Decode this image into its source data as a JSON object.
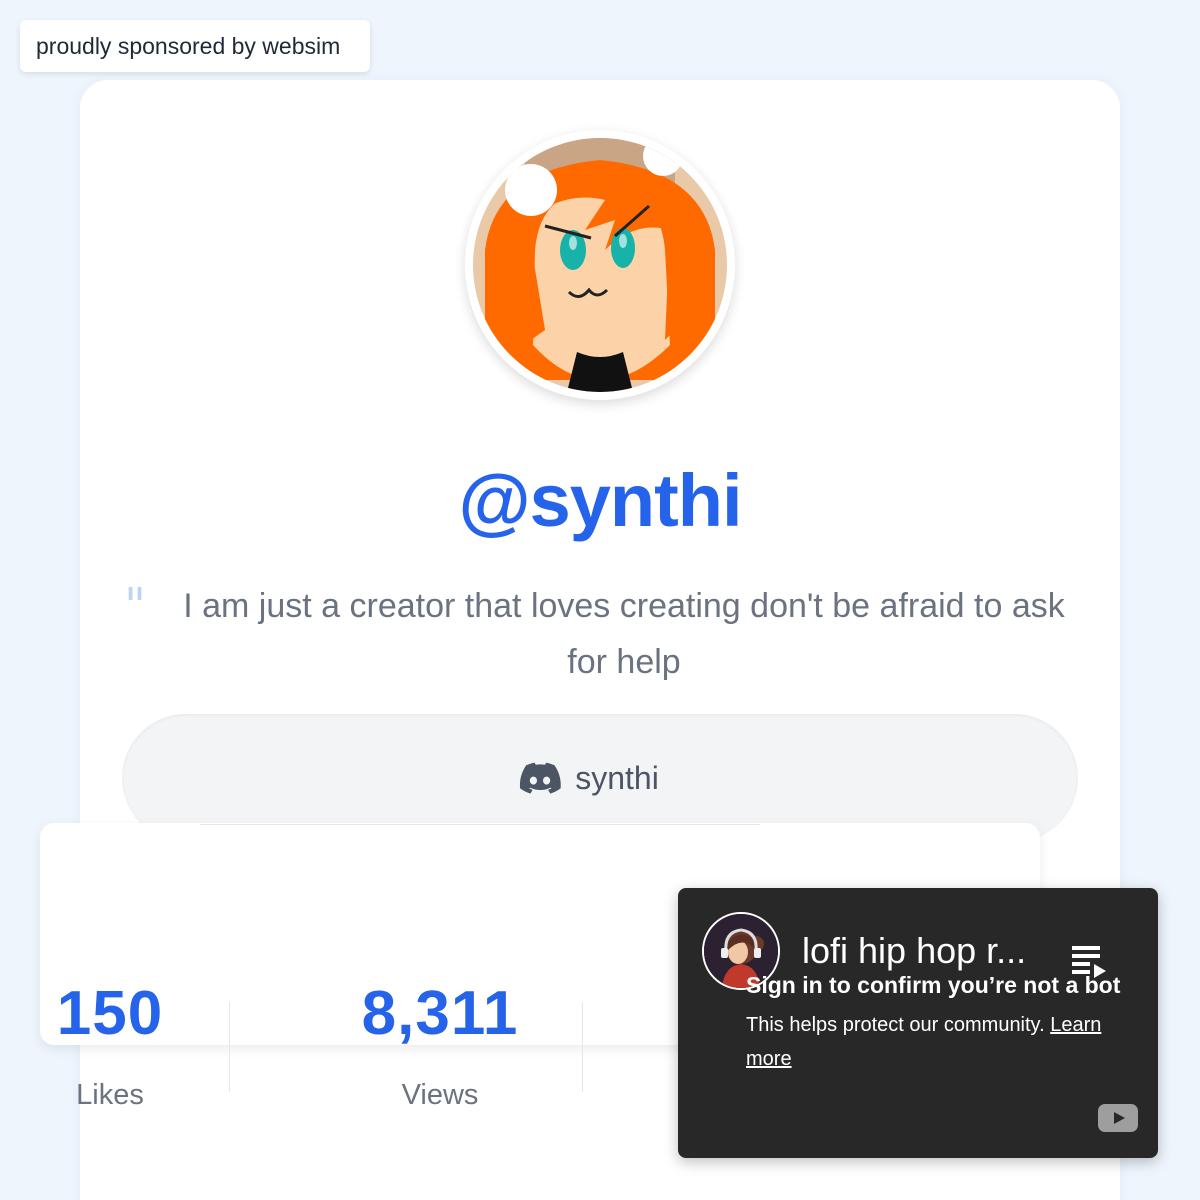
{
  "sponsor": {
    "text": "proudly sponsored by websim"
  },
  "profile": {
    "username": "@synthi",
    "quote_mark": "\"",
    "bio": "I am just a creator that loves creating don't be afraid to ask for help",
    "discord": {
      "icon": "discord-icon",
      "label": "synthi"
    }
  },
  "stats": [
    {
      "value": "150",
      "label": "Likes"
    },
    {
      "value": "8,311",
      "label": "Views"
    }
  ],
  "youtube_popup": {
    "title": "lofi hip hop r...",
    "heading": "Sign in to confirm you’re not a bot",
    "body": "This helps protect our community.",
    "link": "Learn more",
    "icons": [
      "channel-avatar",
      "playlist-icon",
      "youtube-logo-icon"
    ]
  },
  "colors": {
    "accent": "#2563eb",
    "background": "#eef5fd",
    "popup_bg": "#282828"
  }
}
